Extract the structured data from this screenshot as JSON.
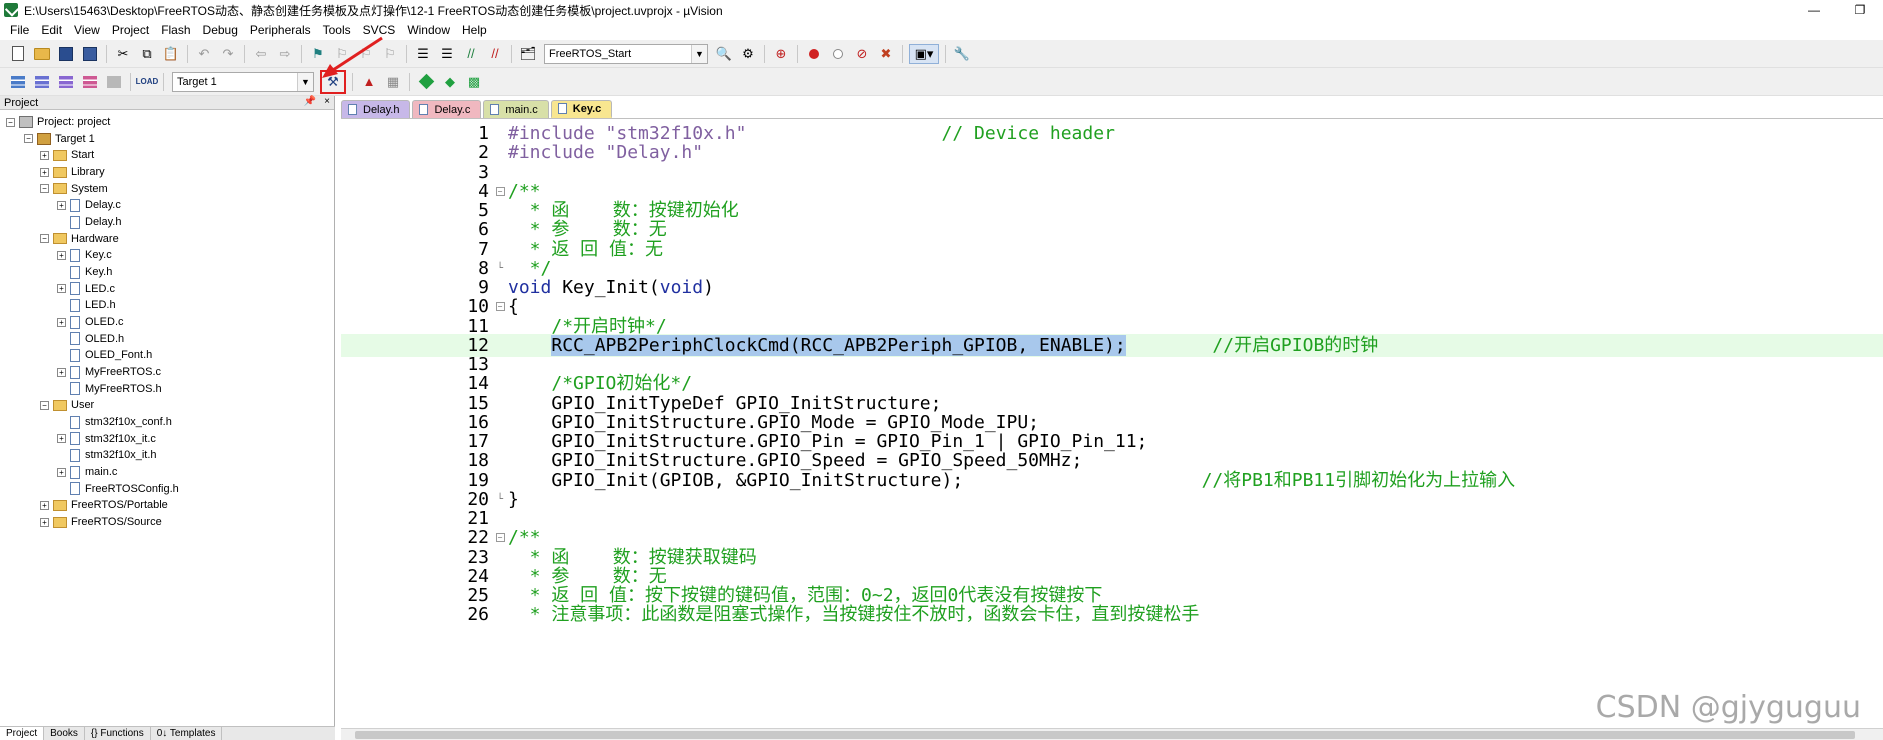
{
  "window": {
    "title": "E:\\Users\\15463\\Desktop\\FreeRTOS动态、静态创建任务模板及点灯操作\\12-1 FreeRTOS动态创建任务模板\\project.uvprojx - µVision",
    "minimize": "—",
    "restore": "❐"
  },
  "menu": [
    "File",
    "Edit",
    "View",
    "Project",
    "Flash",
    "Debug",
    "Peripherals",
    "Tools",
    "SVCS",
    "Window",
    "Help"
  ],
  "toolbar1": {
    "function_combo": "FreeRTOS_Start"
  },
  "toolbar2": {
    "target_combo": "Target 1",
    "load_label": "LOAD"
  },
  "project_panel": {
    "header": "Project",
    "pin": "📌",
    "close": "×",
    "tree": [
      {
        "label": "Project: project",
        "level": 0,
        "kind": "project",
        "exp": "−"
      },
      {
        "label": "Target 1",
        "level": 1,
        "kind": "target",
        "exp": "−"
      },
      {
        "label": "Start",
        "level": 2,
        "kind": "folder",
        "exp": "+"
      },
      {
        "label": "Library",
        "level": 2,
        "kind": "folder",
        "exp": "+"
      },
      {
        "label": "System",
        "level": 2,
        "kind": "folder",
        "exp": "−"
      },
      {
        "label": "Delay.c",
        "level": 3,
        "kind": "file",
        "exp": "+"
      },
      {
        "label": "Delay.h",
        "level": 3,
        "kind": "file",
        "exp": ""
      },
      {
        "label": "Hardware",
        "level": 2,
        "kind": "folder",
        "exp": "−"
      },
      {
        "label": "Key.c",
        "level": 3,
        "kind": "file",
        "exp": "+"
      },
      {
        "label": "Key.h",
        "level": 3,
        "kind": "file",
        "exp": ""
      },
      {
        "label": "LED.c",
        "level": 3,
        "kind": "file",
        "exp": "+"
      },
      {
        "label": "LED.h",
        "level": 3,
        "kind": "file",
        "exp": ""
      },
      {
        "label": "OLED.c",
        "level": 3,
        "kind": "file",
        "exp": "+"
      },
      {
        "label": "OLED.h",
        "level": 3,
        "kind": "file",
        "exp": ""
      },
      {
        "label": "OLED_Font.h",
        "level": 3,
        "kind": "file",
        "exp": ""
      },
      {
        "label": "MyFreeRTOS.c",
        "level": 3,
        "kind": "file",
        "exp": "+"
      },
      {
        "label": "MyFreeRTOS.h",
        "level": 3,
        "kind": "file",
        "exp": ""
      },
      {
        "label": "User",
        "level": 2,
        "kind": "folder",
        "exp": "−"
      },
      {
        "label": "stm32f10x_conf.h",
        "level": 3,
        "kind": "file",
        "exp": ""
      },
      {
        "label": "stm32f10x_it.c",
        "level": 3,
        "kind": "file",
        "exp": "+"
      },
      {
        "label": "stm32f10x_it.h",
        "level": 3,
        "kind": "file",
        "exp": ""
      },
      {
        "label": "main.c",
        "level": 3,
        "kind": "file",
        "exp": "+"
      },
      {
        "label": "FreeRTOSConfig.h",
        "level": 3,
        "kind": "file",
        "exp": ""
      },
      {
        "label": "FreeRTOS/Portable",
        "level": 2,
        "kind": "folder",
        "exp": "+"
      },
      {
        "label": "FreeRTOS/Source",
        "level": 2,
        "kind": "folder",
        "exp": "+"
      }
    ],
    "tabs": [
      "Project",
      "Books",
      "{} Functions",
      "0↓ Templates"
    ]
  },
  "editor_tabs": [
    "Delay.h",
    "Delay.c",
    "main.c",
    "Key.c"
  ],
  "code": [
    {
      "n": "1",
      "fold": "",
      "parts": [
        [
          "pp",
          "#include "
        ],
        [
          "str",
          "\"stm32f10x.h\""
        ],
        [
          "",
          "                  "
        ],
        [
          "cm",
          "// Device header"
        ]
      ]
    },
    {
      "n": "2",
      "fold": "",
      "parts": [
        [
          "pp",
          "#include "
        ],
        [
          "str",
          "\"Delay.h\""
        ]
      ]
    },
    {
      "n": "3",
      "fold": "",
      "parts": []
    },
    {
      "n": "4",
      "fold": "box",
      "parts": [
        [
          "cm",
          "/**"
        ]
      ]
    },
    {
      "n": "5",
      "fold": "",
      "parts": [
        [
          "cm",
          "  * 函    数：按键初始化"
        ]
      ]
    },
    {
      "n": "6",
      "fold": "",
      "parts": [
        [
          "cm",
          "  * 参    数：无"
        ]
      ]
    },
    {
      "n": "7",
      "fold": "",
      "parts": [
        [
          "cm",
          "  * 返 回 值：无"
        ]
      ]
    },
    {
      "n": "8",
      "fold": "end",
      "parts": [
        [
          "cm",
          "  */"
        ]
      ]
    },
    {
      "n": "9",
      "fold": "",
      "parts": [
        [
          "kw",
          "void"
        ],
        [
          "",
          " Key_Init("
        ],
        [
          "kw",
          "void"
        ],
        [
          "",
          ")"
        ]
      ]
    },
    {
      "n": "10",
      "fold": "box",
      "parts": [
        [
          "",
          "{"
        ]
      ]
    },
    {
      "n": "11",
      "fold": "",
      "parts": [
        [
          "",
          "    "
        ],
        [
          "cm",
          "/*开启时钟*/"
        ]
      ]
    },
    {
      "n": "12",
      "fold": "",
      "current": true,
      "parts": [
        [
          "",
          "    "
        ],
        [
          "sel",
          "RCC_APB2PeriphClockCmd(RCC_APB2Periph_GPIOB, ENABLE);"
        ],
        [
          "",
          "        "
        ],
        [
          "cm",
          "//开启GPIOB的时钟"
        ]
      ]
    },
    {
      "n": "13",
      "fold": "",
      "parts": []
    },
    {
      "n": "14",
      "fold": "",
      "parts": [
        [
          "",
          "    "
        ],
        [
          "cm",
          "/*GPIO初始化*/"
        ]
      ]
    },
    {
      "n": "15",
      "fold": "",
      "parts": [
        [
          "",
          "    GPIO_InitTypeDef GPIO_InitStructure;"
        ]
      ]
    },
    {
      "n": "16",
      "fold": "",
      "parts": [
        [
          "",
          "    GPIO_InitStructure.GPIO_Mode = GPIO_Mode_IPU;"
        ]
      ]
    },
    {
      "n": "17",
      "fold": "",
      "parts": [
        [
          "",
          "    GPIO_InitStructure.GPIO_Pin = GPIO_Pin_1 | GPIO_Pin_11;"
        ]
      ]
    },
    {
      "n": "18",
      "fold": "",
      "parts": [
        [
          "",
          "    GPIO_InitStructure.GPIO_Speed = GPIO_Speed_50MHz;"
        ]
      ]
    },
    {
      "n": "19",
      "fold": "",
      "parts": [
        [
          "",
          "    GPIO_Init(GPIOB, &GPIO_InitStructure);                      "
        ],
        [
          "cm",
          "//将PB1和PB11引脚初始化为上拉输入"
        ]
      ]
    },
    {
      "n": "20",
      "fold": "end",
      "parts": [
        [
          "",
          "}"
        ]
      ]
    },
    {
      "n": "21",
      "fold": "",
      "parts": []
    },
    {
      "n": "22",
      "fold": "box",
      "parts": [
        [
          "cm",
          "/**"
        ]
      ]
    },
    {
      "n": "23",
      "fold": "",
      "parts": [
        [
          "cm",
          "  * 函    数：按键获取键码"
        ]
      ]
    },
    {
      "n": "24",
      "fold": "",
      "parts": [
        [
          "cm",
          "  * 参    数：无"
        ]
      ]
    },
    {
      "n": "25",
      "fold": "",
      "parts": [
        [
          "cm",
          "  * 返 回 值：按下按键的键码值，范围：0~2，返回0代表没有按键按下"
        ]
      ]
    },
    {
      "n": "26",
      "fold": "",
      "parts": [
        [
          "cm",
          "  * 注意事项：此函数是阻塞式操作，当按键按住不放时，函数会卡住，直到按键松手"
        ]
      ]
    }
  ],
  "watermark": "CSDN @gjyguguu"
}
